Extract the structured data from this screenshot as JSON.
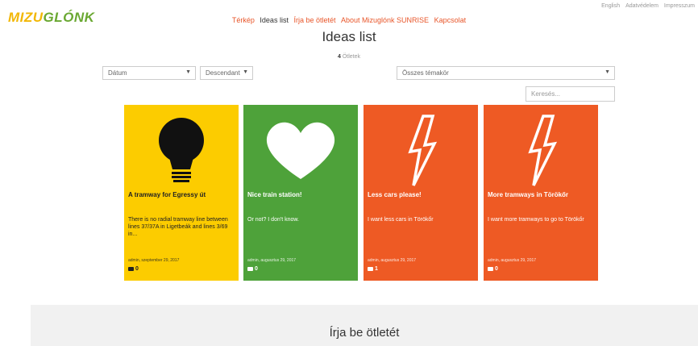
{
  "logo": {
    "part1": "MIZU",
    "part2": "GLÓNK"
  },
  "toplinks": [
    "English",
    "Adatvédelem",
    "Impresszum"
  ],
  "nav": [
    "Térkép",
    "Ideas list",
    "Írja be ötletét",
    "About Mizuglónk SUNRISE",
    "Kapcsolat"
  ],
  "page_title": "Ideas list",
  "count": {
    "number": "4",
    "label": "Ötletek"
  },
  "filters": {
    "sort_field": "Dátum",
    "sort_order": "Descendant",
    "topic": "Összes témakör"
  },
  "search": {
    "placeholder": "Keresés..."
  },
  "ideas": [
    {
      "title": "A tramway for Egressy út",
      "desc": "There is no radial tramway line between lines 37/37A in Ligetbeák and lines 3/69 in...",
      "meta": "admin, szeptember 29, 2017",
      "comments": "0",
      "icon": "lightbulb-icon"
    },
    {
      "title": "Nice train station!",
      "desc": "Or not? I don't know.",
      "meta": "admin, augusztus 29, 2017",
      "comments": "0",
      "icon": "heart-icon"
    },
    {
      "title": "Less cars please!",
      "desc": "I want less cars in Törökőr",
      "meta": "admin, augusztus 29, 2017",
      "comments": "1",
      "icon": "lightning-icon"
    },
    {
      "title": "More tramways in Törökőr",
      "desc": "I want more tramways to go to Törökőr",
      "meta": "admin, augusztus 29, 2017",
      "comments": "0",
      "icon": "lightning-icon"
    }
  ],
  "footer": {
    "title": "Írja be ötletét"
  },
  "colors": {
    "accent": "#e8562a",
    "yellow": "#fccc00",
    "green": "#4ea23a",
    "orange": "#ee5a24"
  }
}
